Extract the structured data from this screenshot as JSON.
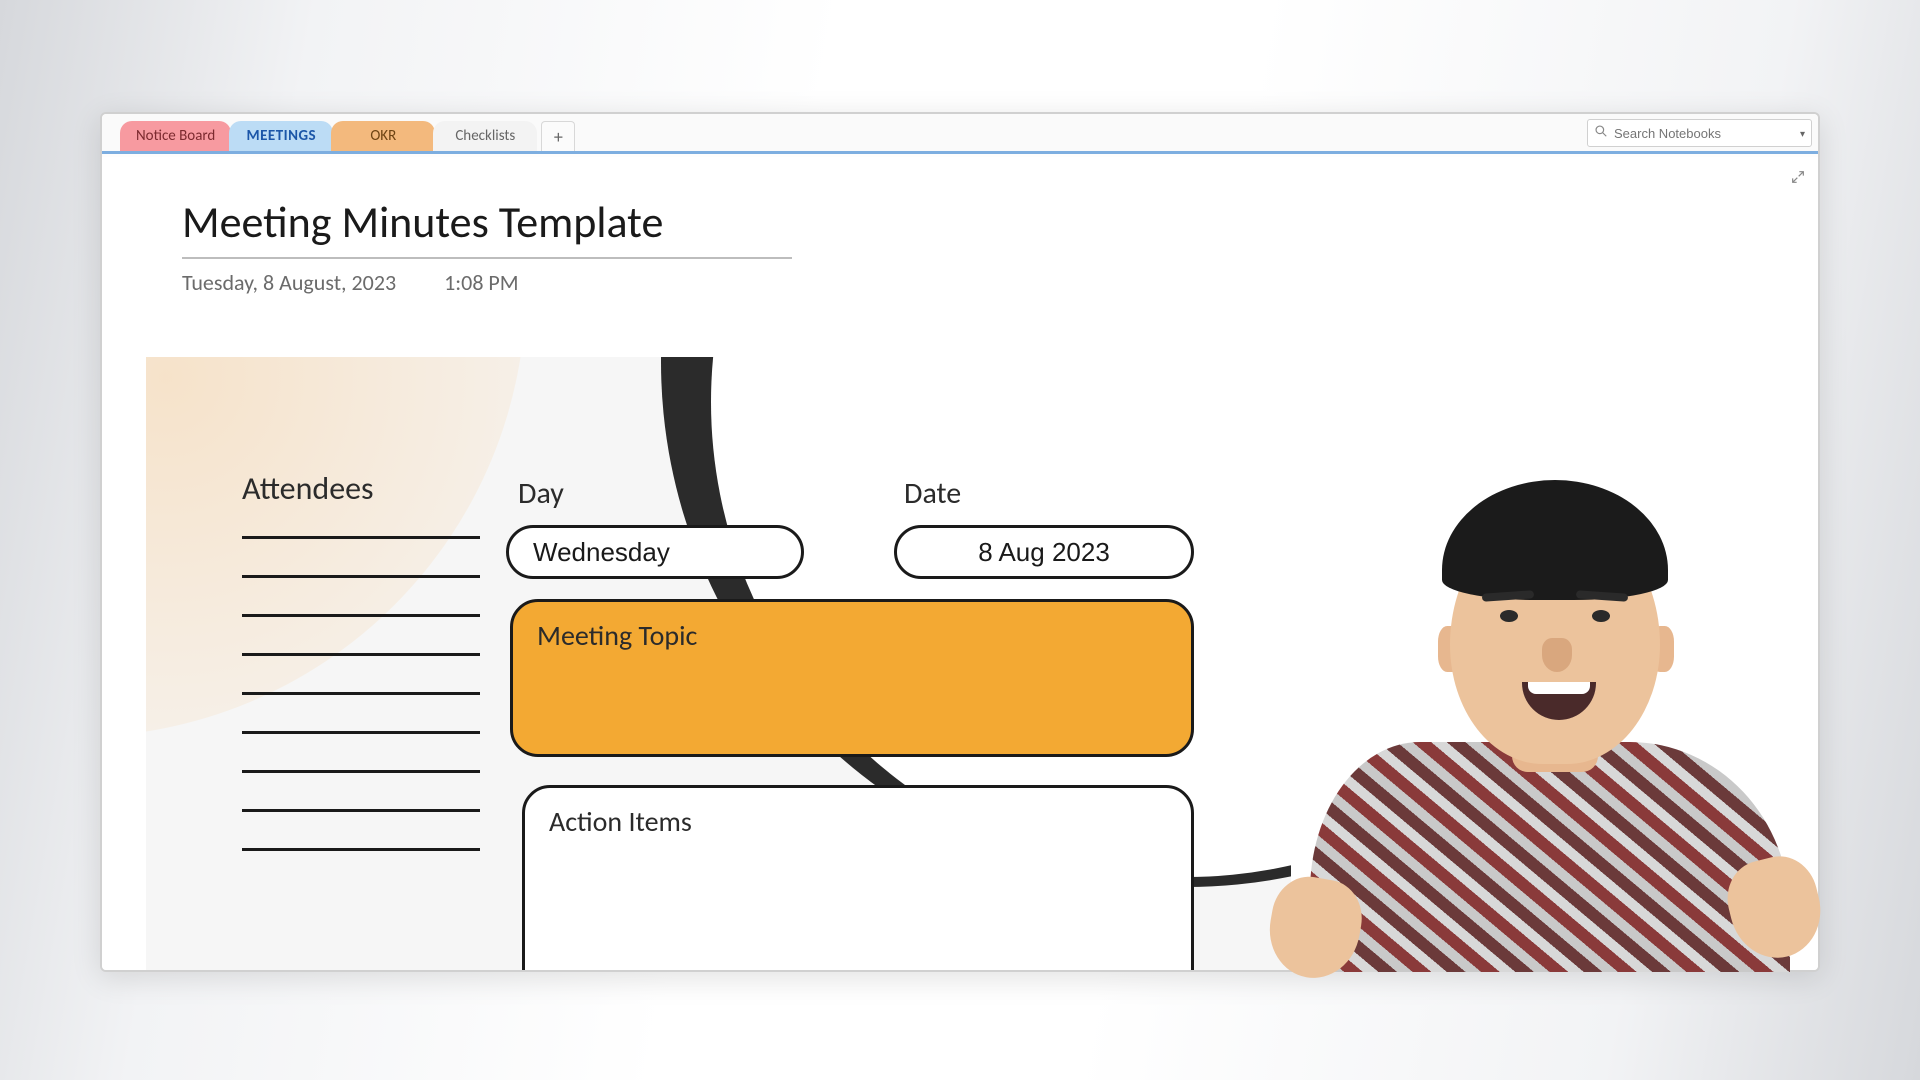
{
  "tabs": {
    "notice": {
      "label": "Notice Board"
    },
    "meetings": {
      "label": "MEETINGS"
    },
    "okr": {
      "label": "OKR"
    },
    "checklists": {
      "label": "Checklists"
    },
    "add_glyph": "+"
  },
  "search": {
    "placeholder": "Search Notebooks"
  },
  "page": {
    "title": "Meeting Minutes Template",
    "date": "Tuesday, 8 August, 2023",
    "time": "1:08 PM"
  },
  "template": {
    "attendees_label": "Attendees",
    "day_label": "Day",
    "date_label": "Date",
    "day_value": "Wednesday",
    "date_value": "8 Aug 2023",
    "meeting_topic_label": "Meeting Topic",
    "action_items_label": "Action Items"
  },
  "colors": {
    "accent": "#f3a933",
    "tab_active": "#bcdcf5"
  }
}
